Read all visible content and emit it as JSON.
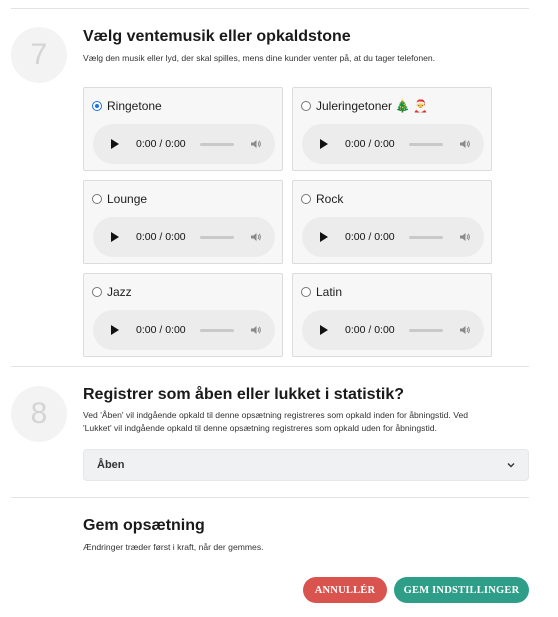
{
  "section7": {
    "number": "7",
    "title": "Vælg ventemusik eller opkaldstone",
    "description": "Vælg den musik eller lyd, der skal spilles, mens dine kunder venter på, at du tager telefonen.",
    "options": [
      {
        "label": "Ringetone",
        "checked": true,
        "time": "0:00 / 0:00"
      },
      {
        "label": "Juleringetoner",
        "emoji": "🎄 🎅",
        "checked": false,
        "time": "0:00 / 0:00"
      },
      {
        "label": "Lounge",
        "checked": false,
        "time": "0:00 / 0:00"
      },
      {
        "label": "Rock",
        "checked": false,
        "time": "0:00 / 0:00"
      },
      {
        "label": "Jazz",
        "checked": false,
        "time": "0:00 / 0:00"
      },
      {
        "label": "Latin",
        "checked": false,
        "time": "0:00 / 0:00"
      }
    ]
  },
  "section8": {
    "number": "8",
    "title": "Registrer som åben eller lukket i statistik?",
    "description_line1": "Ved 'Åben' vil indgående opkald til denne opsætning registreres som opkald inden for åbningstid. Ved",
    "description_line2": "'Lukket' vil indgående opkald til denne opsætning registreres som opkald uden for åbningstid.",
    "select_value": "Åben"
  },
  "save_section": {
    "title": "Gem opsætning",
    "description": "Ændringer træder først i kraft, når der gemmes.",
    "cancel_label": "ANNULLÉR",
    "save_label": "GEM INDSTILLINGER"
  },
  "colors": {
    "cancel": "#d9534f",
    "save": "#2e9e88",
    "radio_selected": "#1a73e8"
  }
}
